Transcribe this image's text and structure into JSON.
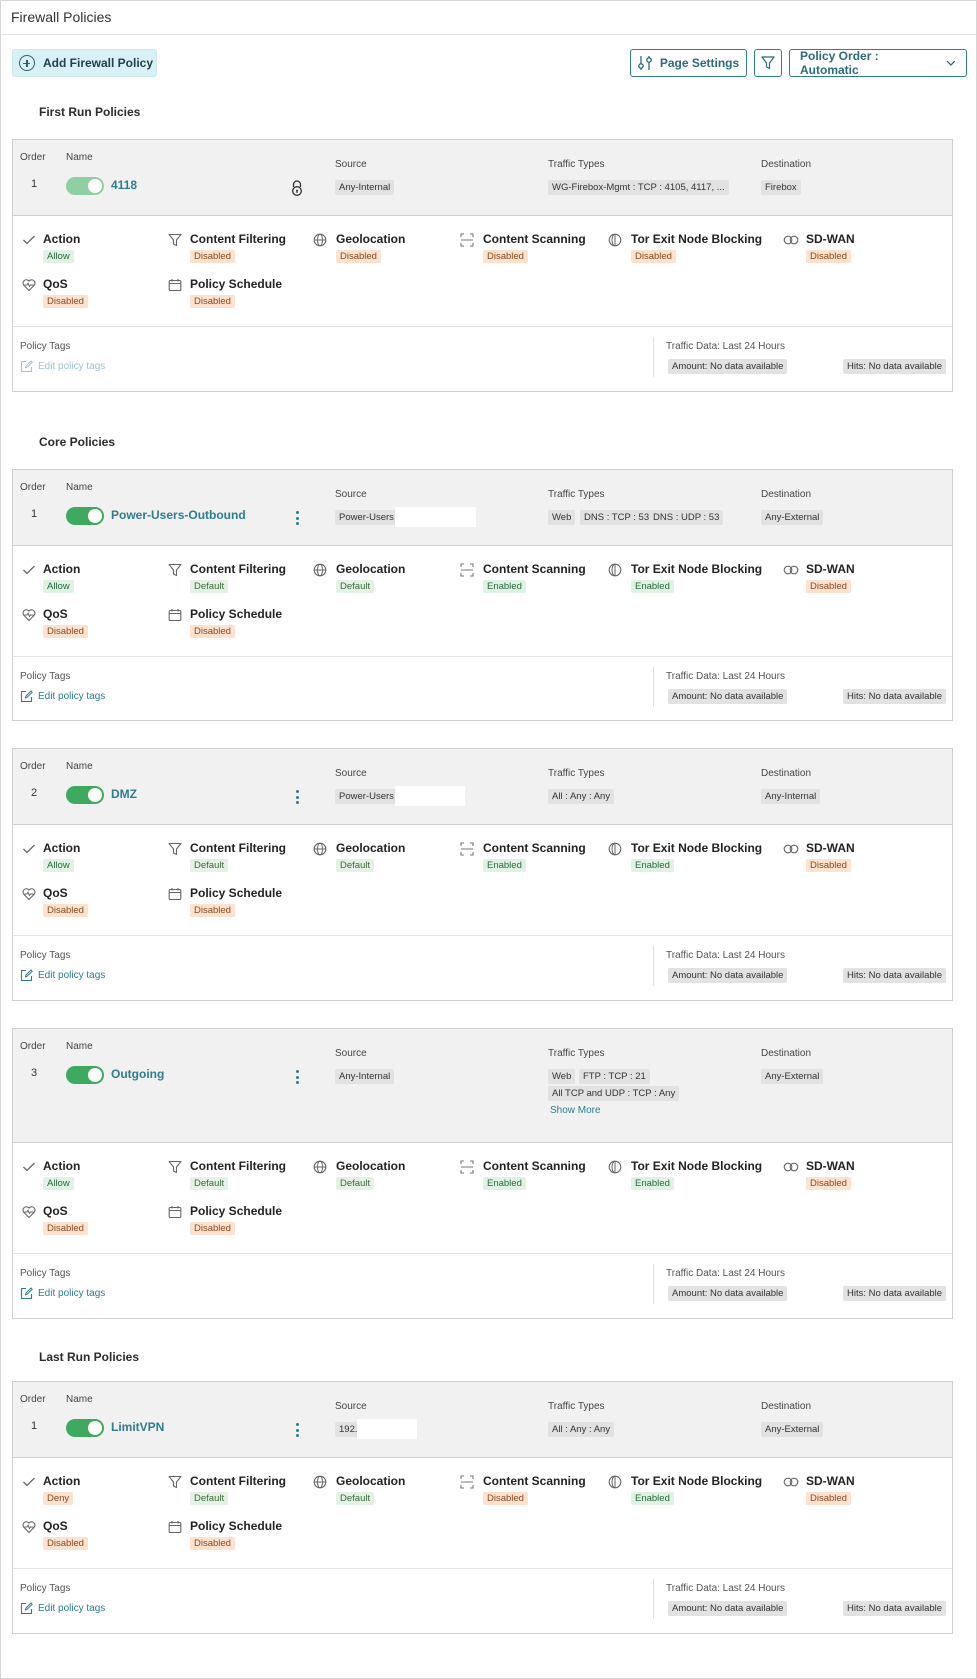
{
  "page": {
    "title": "Firewall Policies"
  },
  "toolbar": {
    "add_label": "Add Firewall Policy",
    "page_settings_label": "Page Settings",
    "policy_order_label": "Policy Order : Automatic"
  },
  "labels": {
    "order": "Order",
    "name": "Name",
    "source": "Source",
    "traffic_types": "Traffic Types",
    "destination": "Destination",
    "policy_tags": "Policy Tags",
    "edit_policy_tags": "Edit policy tags",
    "traffic_data": "Traffic Data: Last 24 Hours",
    "amount": "Amount: No data available",
    "hits": "Hits: No data available",
    "show_more": "Show More",
    "features": {
      "action": "Action",
      "content_filtering": "Content Filtering",
      "geolocation": "Geolocation",
      "content_scanning": "Content Scanning",
      "tor": "Tor Exit Node Blocking",
      "sdwan": "SD-WAN",
      "qos": "QoS",
      "schedule": "Policy Schedule"
    }
  },
  "sections": [
    {
      "title": "First Run Policies"
    },
    {
      "title": "Core Policies"
    },
    {
      "title": "Last Run Policies"
    }
  ],
  "policies": [
    {
      "order": "1",
      "name": "4118",
      "enabled": true,
      "locked": true,
      "source": "Any-Internal",
      "traffic": [
        "WG-Firebox-Mgmt : TCP : 4105, 4117, ..."
      ],
      "destination": "Firebox",
      "action": "Allow",
      "content_filtering": "Disabled",
      "geolocation": "Disabled",
      "content_scanning": "Disabled",
      "tor": "Disabled",
      "sdwan": "Disabled",
      "qos": "Disabled",
      "schedule": "Disabled"
    },
    {
      "order": "1",
      "name": "Power-Users-Outbound",
      "enabled": true,
      "source": "Power-Users",
      "traffic": [
        "Web",
        "DNS : TCP : 53",
        "DNS : UDP : 53"
      ],
      "destination": "Any-External",
      "action": "Allow",
      "content_filtering": "Default",
      "geolocation": "Default",
      "content_scanning": "Enabled",
      "tor": "Enabled",
      "sdwan": "Disabled",
      "qos": "Disabled",
      "schedule": "Disabled"
    },
    {
      "order": "2",
      "name": "DMZ",
      "enabled": true,
      "source": "Power-Users",
      "traffic": [
        "All : Any : Any"
      ],
      "destination": "Any-Internal",
      "action": "Allow",
      "content_filtering": "Default",
      "geolocation": "Default",
      "content_scanning": "Enabled",
      "tor": "Enabled",
      "sdwan": "Disabled",
      "qos": "Disabled",
      "schedule": "Disabled"
    },
    {
      "order": "3",
      "name": "Outgoing",
      "enabled": true,
      "source": "Any-Internal",
      "traffic": [
        "Web",
        "FTP : TCP : 21",
        "All TCP and UDP : TCP : Any"
      ],
      "destination": "Any-External",
      "action": "Allow",
      "content_filtering": "Default",
      "geolocation": "Default",
      "content_scanning": "Enabled",
      "tor": "Enabled",
      "sdwan": "Disabled",
      "qos": "Disabled",
      "schedule": "Disabled"
    },
    {
      "order": "1",
      "name": "LimitVPN",
      "enabled": true,
      "source": "192.",
      "traffic": [
        "All : Any : Any"
      ],
      "destination": "Any-External",
      "action": "Deny",
      "content_filtering": "Default",
      "geolocation": "Default",
      "content_scanning": "Disabled",
      "tor": "Enabled",
      "sdwan": "Disabled",
      "qos": "Disabled",
      "schedule": "Disabled"
    }
  ],
  "colors": {
    "accent": "#2d7d8f",
    "toggle_on": "#3fa95f",
    "badge_green": "#dff2e3",
    "badge_orange": "#fde2cf",
    "add_button_bg": "#d8f1f6"
  }
}
